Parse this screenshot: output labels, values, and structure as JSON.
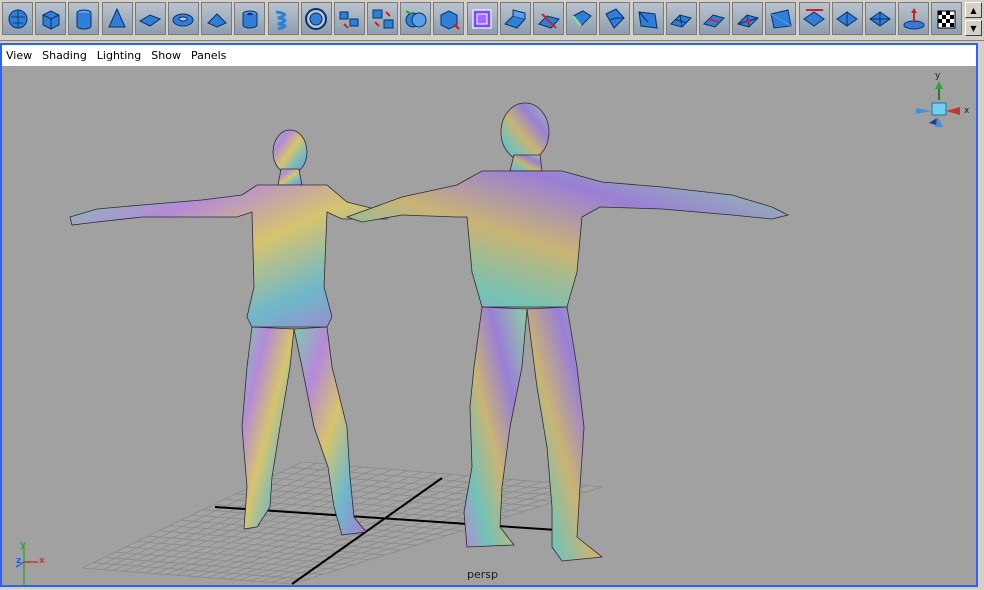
{
  "shelf": {
    "tools": [
      {
        "name": "poly-sphere-icon"
      },
      {
        "name": "poly-cube-icon"
      },
      {
        "name": "poly-cylinder-icon"
      },
      {
        "name": "poly-cone-icon"
      },
      {
        "name": "poly-plane-icon"
      },
      {
        "name": "poly-torus-icon"
      },
      {
        "name": "poly-prism-icon"
      },
      {
        "name": "poly-pipe-icon"
      },
      {
        "name": "poly-helix-icon"
      },
      {
        "name": "poly-soccer-ball-icon"
      },
      {
        "name": "combine-icon"
      },
      {
        "name": "separate-icon"
      },
      {
        "name": "boolean-union-icon"
      },
      {
        "name": "smooth-icon"
      },
      {
        "name": "smooth-proxy-icon"
      },
      {
        "name": "extrude-face-icon"
      },
      {
        "name": "split-polygon-icon"
      },
      {
        "name": "bevel-icon"
      },
      {
        "name": "wedge-face-icon"
      },
      {
        "name": "extrude-edge-icon"
      },
      {
        "name": "subdivide-icon"
      },
      {
        "name": "merge-vertices-icon"
      },
      {
        "name": "append-polygon-icon"
      },
      {
        "name": "poke-face-icon"
      },
      {
        "name": "planar-mapping-icon"
      },
      {
        "name": "cylindrical-mapping-icon"
      },
      {
        "name": "automatic-mapping-icon"
      },
      {
        "name": "uv-texture-editor-icon"
      },
      {
        "name": "checker-texture-icon"
      }
    ],
    "scroll_up": "▲",
    "scroll_down": "▼"
  },
  "panel": {
    "menus": [
      "View",
      "Shading",
      "Lighting",
      "Show",
      "Panels"
    ],
    "camera_label": "persp",
    "view_cube": {
      "x_label": "x",
      "y_label": "y"
    },
    "axis_indicator": {
      "x_label": "x",
      "y_label": "y",
      "z_label": "z"
    }
  },
  "colors": {
    "viewport_bg": "#a1a1a1",
    "panel_border": "#2a62ff",
    "grid": "#8a8a8a",
    "grid_axis": "#000000"
  }
}
